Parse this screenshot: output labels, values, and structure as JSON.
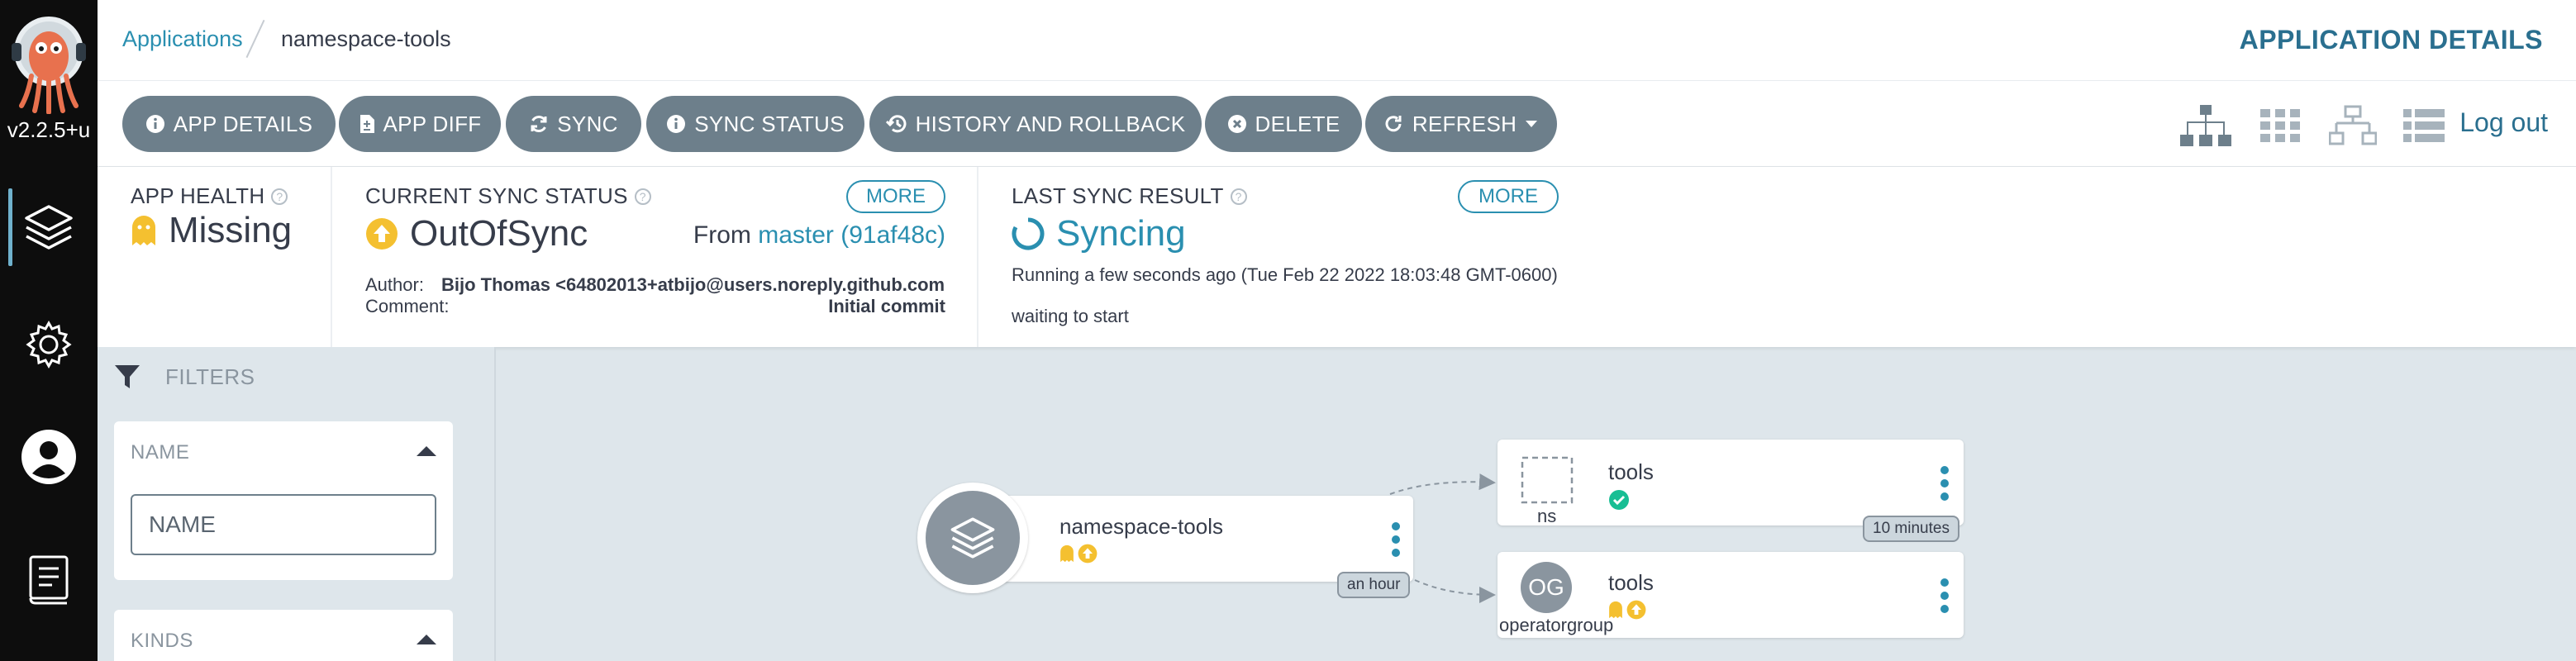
{
  "app": {
    "version": "v2.2.5+u",
    "colors": {
      "accent": "#2a8fb0",
      "toolbar_button": "#6d7f8b",
      "sidebar": "#0d0d0d",
      "canvas": "#dee6eb",
      "health_missing": "#f4c030",
      "sync_outofsync": "#f4c030",
      "healthy": "#18be94"
    }
  },
  "sidebar": {
    "items": [
      {
        "name": "applications",
        "icon": "layers-icon"
      },
      {
        "name": "settings",
        "icon": "gear-icon"
      },
      {
        "name": "user-info",
        "icon": "user-icon"
      },
      {
        "name": "documentation",
        "icon": "book-icon"
      }
    ]
  },
  "header": {
    "breadcrumb_root": "Applications",
    "breadcrumb_current": "namespace-tools",
    "title": "APPLICATION DETAILS"
  },
  "toolbar": {
    "buttons": [
      {
        "label": "APP DETAILS",
        "icon": "info-icon"
      },
      {
        "label": "APP DIFF",
        "icon": "file-diff-icon"
      },
      {
        "label": "SYNC",
        "icon": "sync-icon"
      },
      {
        "label": "SYNC STATUS",
        "icon": "info-icon"
      },
      {
        "label": "HISTORY AND ROLLBACK",
        "icon": "history-icon"
      },
      {
        "label": "DELETE",
        "icon": "times-circle-icon"
      },
      {
        "label": "REFRESH",
        "icon": "redo-icon"
      }
    ],
    "views": [
      "tree-view-icon",
      "pods-view-icon",
      "network-view-icon",
      "list-view-icon"
    ],
    "logout": "Log out"
  },
  "status": {
    "health": {
      "label": "APP HEALTH",
      "value": "Missing"
    },
    "sync": {
      "label": "CURRENT SYNC STATUS",
      "value": "OutOfSync",
      "from_prefix": "From",
      "revision": "master (91af48c)",
      "more": "MORE",
      "author_label": "Author:",
      "author_value": "Bijo Thomas <64802013+atbijo@users.noreply.github.com...",
      "comment_label": "Comment:",
      "comment_value": "Initial commit"
    },
    "last_sync": {
      "label": "LAST SYNC RESULT",
      "value": "Syncing",
      "more": "MORE",
      "running": "Running a few seconds ago (Tue Feb 22 2022 18:03:48 GMT-0600)",
      "message": "waiting to start"
    }
  },
  "filters": {
    "title": "FILTERS",
    "name_title": "NAME",
    "name_placeholder": "NAME",
    "kinds_title": "KINDS"
  },
  "graph": {
    "app_node": {
      "name": "namespace-tools",
      "age": "an hour"
    },
    "resources": [
      {
        "name": "tools",
        "kind": "ns",
        "age": "10 minutes",
        "status": "healthy"
      },
      {
        "name": "tools",
        "kind": "operatorgroup",
        "abbr": "OG",
        "status": "missing-outofsync"
      }
    ]
  }
}
